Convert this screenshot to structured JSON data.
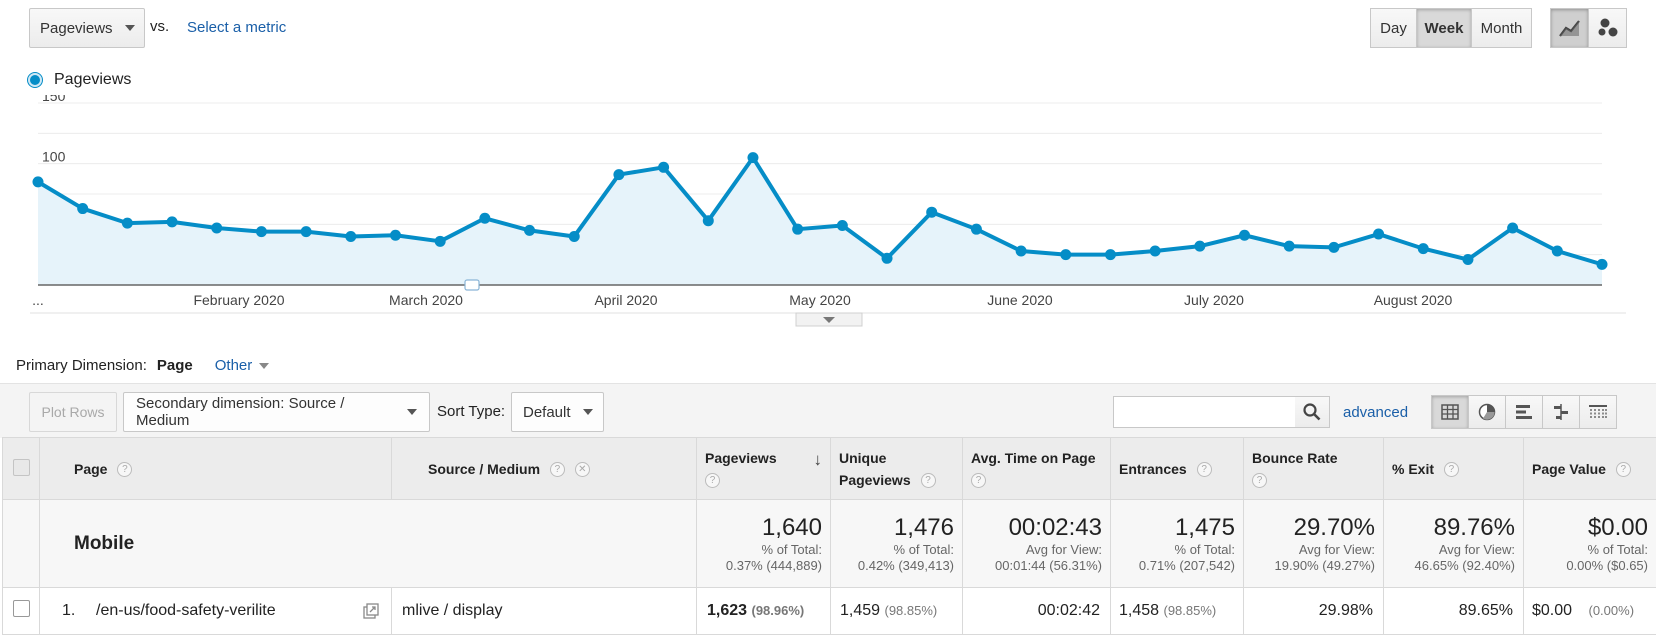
{
  "header": {
    "metric_dropdown": "Pageviews",
    "vs_label": "vs.",
    "select_metric_link": "Select a metric",
    "period_buttons": [
      "Day",
      "Week",
      "Month"
    ],
    "active_period": "Week",
    "chart_type_icons": [
      "line-chart-icon",
      "motion-chart-icon"
    ]
  },
  "chart_data": {
    "type": "area",
    "legend": "Pageviews",
    "color": "#058dc7",
    "ylim": [
      0,
      150
    ],
    "y_ticks": [
      50,
      100,
      150
    ],
    "x_tick_labels": [
      "...",
      "February 2020",
      "March 2020",
      "April 2020",
      "May 2020",
      "June 2020",
      "July 2020",
      "August 2020"
    ],
    "series": [
      {
        "name": "Pageviews",
        "values": [
          85,
          63,
          51,
          52,
          47,
          44,
          44,
          40,
          41,
          36,
          55,
          45,
          40,
          91,
          97,
          53,
          105,
          46,
          49,
          22,
          60,
          46,
          28,
          25,
          25,
          28,
          32,
          41,
          32,
          31,
          42,
          30,
          21,
          47,
          28,
          17
        ]
      }
    ]
  },
  "primary_dimension": {
    "label": "Primary Dimension:",
    "selected": "Page",
    "other": "Other"
  },
  "toolbar": {
    "plot_rows": "Plot Rows",
    "secondary_dimension": "Secondary dimension: Source / Medium",
    "sort_type_label": "Sort Type:",
    "sort_type": "Default",
    "search_value": "",
    "advanced_link": "advanced",
    "view_icons": [
      "table-view-icon",
      "pie-view-icon",
      "bar-view-icon",
      "comparison-view-icon",
      "pivot-view-icon"
    ]
  },
  "table": {
    "headers": {
      "page": "Page",
      "source_medium": "Source / Medium",
      "pageviews": "Pageviews",
      "unique_pageviews": "Unique Pageviews",
      "avg_time": "Avg. Time on Page",
      "entrances": "Entrances",
      "bounce_rate": "Bounce Rate",
      "exit": "% Exit",
      "page_value": "Page Value"
    },
    "summary": {
      "label": "Mobile",
      "pageviews": "1,640",
      "pageviews_sub1": "% of Total:",
      "pageviews_sub2": "0.37% (444,889)",
      "unique_pageviews": "1,476",
      "unique_sub1": "% of Total:",
      "unique_sub2": "0.42% (349,413)",
      "avg_time": "00:02:43",
      "avg_time_sub1": "Avg for View:",
      "avg_time_sub2": "00:01:44 (56.31%)",
      "entrances": "1,475",
      "entrances_sub1": "% of Total:",
      "entrances_sub2": "0.71% (207,542)",
      "bounce_rate": "29.70%",
      "bounce_sub1": "Avg for View:",
      "bounce_sub2": "19.90% (49.27%)",
      "exit": "89.76%",
      "exit_sub1": "Avg for View:",
      "exit_sub2": "46.65% (92.40%)",
      "page_value": "$0.00",
      "page_value_sub1": "% of Total:",
      "page_value_sub2": "0.00% ($0.65)"
    },
    "rows": [
      {
        "index": "1.",
        "page": "/en-us/food-safety-verilite",
        "source_medium": "mlive / display",
        "pageviews": "1,623",
        "pageviews_pct": "(98.96%)",
        "unique_pageviews": "1,459",
        "unique_pct": "(98.85%)",
        "avg_time": "00:02:42",
        "entrances": "1,458",
        "entrances_pct": "(98.85%)",
        "bounce_rate": "29.98%",
        "exit": "89.65%",
        "page_value": "$0.00",
        "page_value_pct": "(0.00%)"
      }
    ]
  }
}
